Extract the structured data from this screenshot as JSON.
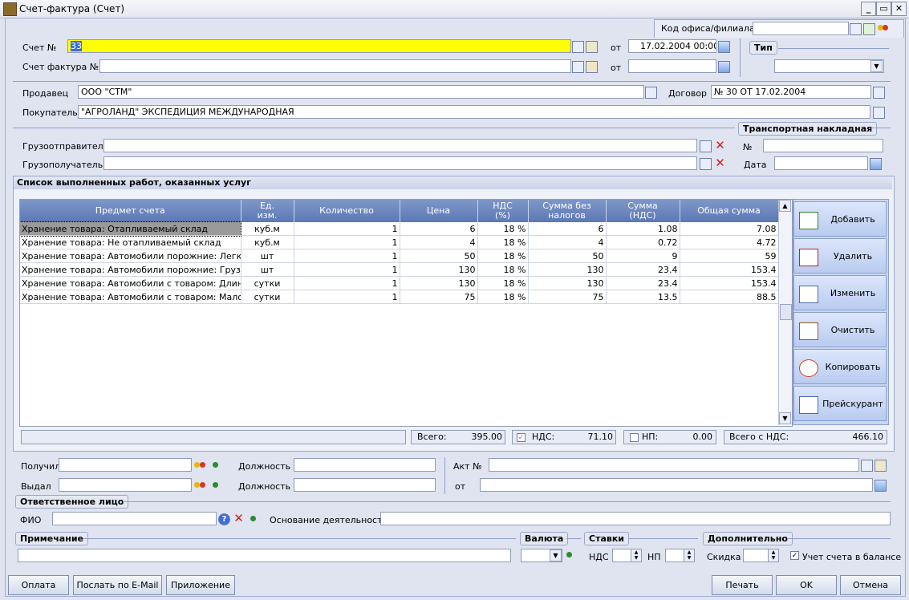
{
  "window": {
    "title": "Счет-фактура (Счет)",
    "min": "_",
    "max": "▭",
    "close": "✕"
  },
  "office": {
    "label": "Код офиса/филиала",
    "value": ""
  },
  "invoice": {
    "schet_label": "Счет №",
    "schet_value": "33",
    "from1": "от",
    "date1": "17.02.2004 00:00",
    "sf_label": "Счет фактура №",
    "sf_value": "",
    "from2": "от",
    "date2": ""
  },
  "type": {
    "label": "Тип",
    "value": ""
  },
  "parties": {
    "seller_label": "Продавец",
    "seller": "ООО \"СТМ\"",
    "contract_label": "Договор",
    "contract": "№ 30 ОТ 17.02.2004",
    "buyer_label": "Покупатель",
    "buyer": "\"АГРОЛАНД\" ЭКСПЕДИЦИЯ МЕЖДУНАРОДНАЯ"
  },
  "shipping": {
    "transport_label": "Транспортная накладная",
    "shipper_label": "Грузоотправитель",
    "shipper": "",
    "consignee_label": "Грузополучатель",
    "consignee": "",
    "no_label": "№",
    "no": "",
    "date_label": "Дата",
    "date": ""
  },
  "list": {
    "title": "Список выполненных работ, оказанных услуг",
    "columns": [
      "Предмет счета",
      "Ед.\nизм.",
      "Количество",
      "Цена",
      "НДС\n(%)",
      "Сумма без\nналогов",
      "Сумма\n(НДС)",
      "Общая сумма"
    ],
    "rows": [
      [
        "Хранение товара: Отапливаемый склад",
        "куб.м",
        "1",
        "6",
        "18 %",
        "6",
        "1.08",
        "7.08"
      ],
      [
        "Хранение товара: Не отапливаемый склад",
        "куб.м",
        "1",
        "4",
        "18 %",
        "4",
        "0.72",
        "4.72"
      ],
      [
        "Хранение товара: Автомобили порожние: Легковые",
        "шт",
        "1",
        "50",
        "18 %",
        "50",
        "9",
        "59"
      ],
      [
        "Хранение товара: Автомобили порожние: Грузовые",
        "шт",
        "1",
        "130",
        "18 %",
        "130",
        "23.4",
        "153.4"
      ],
      [
        "Хранение товара: Автомобили с товаром: Длинномер",
        "сутки",
        "1",
        "130",
        "18 %",
        "130",
        "23.4",
        "153.4"
      ],
      [
        "Хранение товара: Автомобили с товаром: Малогабар",
        "сутки",
        "1",
        "75",
        "18 %",
        "75",
        "13.5",
        "88.5"
      ]
    ]
  },
  "side_buttons": [
    "Добавить",
    "Удалить",
    "Изменить",
    "Очистить",
    "Копировать",
    "Прейскурант"
  ],
  "totals": {
    "total_label": "Всего:",
    "total": "395.00",
    "vat_label": "НДС:",
    "vat": "71.10",
    "np_label": "НП:",
    "np": "0.00",
    "with_vat_label": "Всего с НДС:",
    "with_vat": "466.10"
  },
  "people": {
    "received_label": "Получил",
    "received": "",
    "pos_label1": "Должность",
    "pos1": "",
    "issued_label": "Выдал",
    "issued": "",
    "pos_label2": "Должность",
    "pos2": "",
    "act_label": "Акт №",
    "act": "",
    "act_from": "от",
    "act_date": ""
  },
  "responsible": {
    "title": "Ответственное лицо",
    "fio_label": "ФИО",
    "fio": "",
    "basis_label": "Основание деятельности",
    "basis": ""
  },
  "note": {
    "title": "Примечание",
    "value": ""
  },
  "currency": {
    "title": "Валюта",
    "value": ""
  },
  "rates": {
    "title": "Ставки",
    "vat_label": "НДС",
    "vat": "",
    "np_label": "НП",
    "np": ""
  },
  "extra": {
    "title": "Дополнительно",
    "discount_label": "Скидка",
    "discount": "",
    "balance_label": "Учет счета в балансе",
    "balance_checked": true
  },
  "footer": {
    "pay": "Оплата",
    "email": "Послать по E-Mail",
    "attach": "Приложение",
    "print": "Печать",
    "ok": "OK",
    "cancel": "Отмена"
  }
}
